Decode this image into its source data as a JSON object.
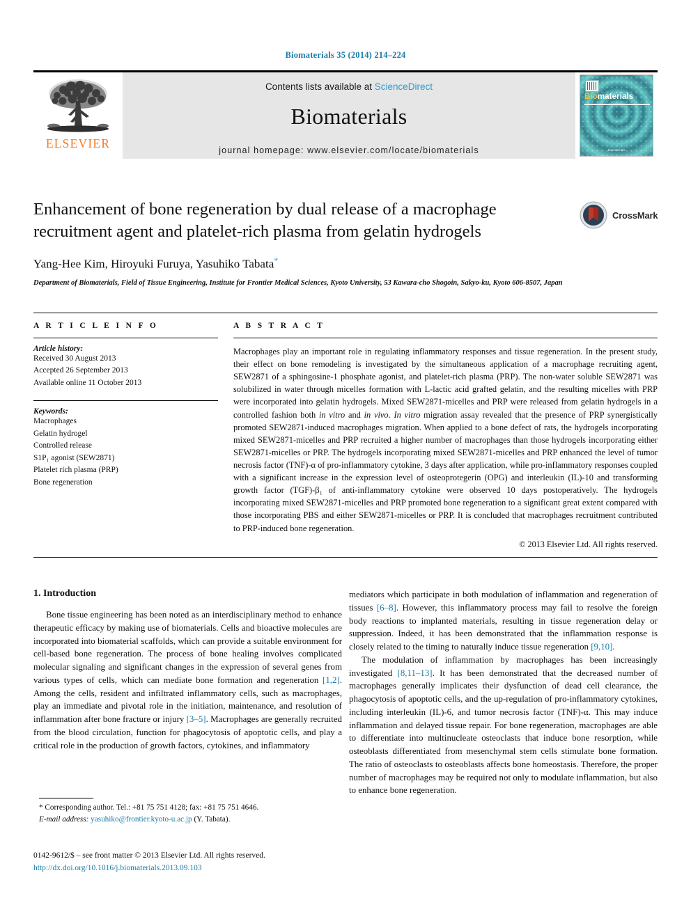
{
  "running_head": "Biomaterials 35 (2014) 214–224",
  "masthead": {
    "contents_prefix": "Contents lists available at ",
    "sciencedirect": "ScienceDirect",
    "journal_name": "Biomaterials",
    "homepage": "journal homepage: www.elsevier.com/locate/biomaterials",
    "publisher_logo_text": "ELSEVIER",
    "cover": {
      "title_bio": "Bio",
      "title_rest": "materials",
      "footer": "Biomaterials"
    },
    "colors": {
      "link": "#2e9ad0",
      "elsevier_orange": "#f47920",
      "panel_gray": "#e6e6e6"
    }
  },
  "article": {
    "title": "Enhancement of bone regeneration by dual release of a macrophage recruitment agent and platelet-rich plasma from gelatin hydrogels",
    "authors": "Yang-Hee Kim, Hiroyuki Furuya, Yasuhiko Tabata",
    "corresponding_marker": "*",
    "affiliation": "Department of Biomaterials, Field of Tissue Engineering, Institute for Frontier Medical Sciences, Kyoto University, 53 Kawara-cho Shogoin, Sakyo-ku, Kyoto 606-8507, Japan",
    "crossmark_label": "CrossMark"
  },
  "article_info": {
    "heading": "A R T I C L E   I N F O",
    "history_label": "Article history:",
    "history": [
      "Received 30 August 2013",
      "Accepted 26 September 2013",
      "Available online 11 October 2013"
    ],
    "keywords_label": "Keywords:",
    "keywords": [
      "Macrophages",
      "Gelatin hydrogel",
      "Controlled release",
      "S1P₁ agonist (SEW2871)",
      "Platelet rich plasma (PRP)",
      "Bone regeneration"
    ]
  },
  "abstract": {
    "heading": "A B S T R A C T",
    "paragraphs": [
      "Macrophages play an important role in regulating inflammatory responses and tissue regeneration. In the present study, their effect on bone remodeling is investigated by the simultaneous application of a macrophage recruiting agent, SEW2871 of a sphingosine-1 phosphate agonist, and platelet-rich plasma (PRP). The non-water soluble SEW2871 was solubilized in water through micelles formation with L-lactic acid grafted gelatin, and the resulting micelles with PRP were incorporated into gelatin hydrogels. Mixed SEW2871-micelles and PRP were released from gelatin hydrogels in a controlled fashion both in vitro and in vivo. In vitro migration assay revealed that the presence of PRP synergistically promoted SEW2871-induced macrophages migration. When applied to a bone defect of rats, the hydrogels incorporating mixed SEW2871-micelles and PRP recruited a higher number of macrophages than those hydrogels incorporating either SEW2871-micelles or PRP. The hydrogels incorporating mixed SEW2871-micelles and PRP enhanced the level of tumor necrosis factor (TNF)-α of pro-inflammatory cytokine, 3 days after application, while pro-inflammatory responses coupled with a significant increase in the expression level of osteoprotegerin (OPG) and interleukin (IL)-10 and transforming growth factor (TGF)-β₁ of anti-inflammatory cytokine were observed 10 days postoperatively. The hydrogels incorporating mixed SEW2871-micelles and PRP promoted bone regeneration to a significant great extent compared with those incorporating PBS and either SEW2871-micelles or PRP. It is concluded that macrophages recruitment contributed to PRP-induced bone regeneration."
    ],
    "copyright": "© 2013 Elsevier Ltd. All rights reserved."
  },
  "introduction": {
    "heading": "1.  Introduction",
    "left_paragraphs": [
      "Bone tissue engineering has been noted as an interdisciplinary method to enhance therapeutic efficacy by making use of biomaterials. Cells and bioactive molecules are incorporated into biomaterial scaffolds, which can provide a suitable environment for cell-based bone regeneration. The process of bone healing involves complicated molecular signaling and significant changes in the expression of several genes from various types of cells, which can mediate bone formation and regeneration [1,2]. Among the cells, resident and infiltrated inflammatory cells, such as macrophages, play an immediate and pivotal role in the initiation, maintenance, and resolution of inflammation after bone fracture or injury [3–5]. Macrophages are generally recruited from the blood circulation, function for phagocytosis of apoptotic cells, and play a critical role in the production of growth factors, cytokines, and inflammatory"
    ],
    "right_paragraphs": [
      "mediators which participate in both modulation of inflammation and regeneration of tissues [6–8]. However, this inflammatory process may fail to resolve the foreign body reactions to implanted materials, resulting in tissue regeneration delay or suppression. Indeed, it has been demonstrated that the inflammation response is closely related to the timing to naturally induce tissue regeneration [9,10].",
      "The modulation of inflammation by macrophages has been increasingly investigated [8,11–13]. It has been demonstrated that the decreased number of macrophages generally implicates their dysfunction of dead cell clearance, the phagocytosis of apoptotic cells, and the up-regulation of pro-inflammatory cytokines, including interleukin (IL)-6, and tumor necrosis factor (TNF)-α. This may induce inflammation and delayed tissue repair. For bone regeneration, macrophages are able to differentiate into multinucleate osteoclasts that induce bone resorption, while osteoblasts differentiated from mesenchymal stem cells stimulate bone formation. The ratio of osteoclasts to osteoblasts affects bone homeostasis. Therefore, the proper number of macrophages may be required not only to modulate inflammation, but also to enhance bone regeneration."
    ]
  },
  "footnote": {
    "corresponding": "* Corresponding author. Tel.: +81 75 751 4128; fax: +81 75 751 4646.",
    "email_label": "E-mail address:",
    "email": "yasuhiko@frontier.kyoto-u.ac.jp",
    "email_suffix": "(Y. Tabata)."
  },
  "footer": {
    "front_matter": "0142-9612/$ – see front matter © 2013 Elsevier Ltd. All rights reserved.",
    "doi": "http://dx.doi.org/10.1016/j.biomaterials.2013.09.103"
  }
}
